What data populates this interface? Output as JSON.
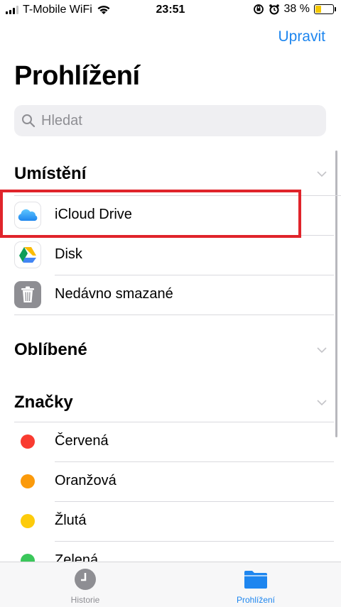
{
  "status": {
    "carrier": "T-Mobile WiFi",
    "time": "23:51",
    "battery": "38 %",
    "battery_level": 0.38
  },
  "header": {
    "edit_label": "Upravit",
    "title": "Prohlížení"
  },
  "search": {
    "placeholder": "Hledat"
  },
  "sections": {
    "locations": {
      "title": "Umístění",
      "items": [
        {
          "label": "iCloud Drive",
          "icon": "icloud-icon"
        },
        {
          "label": "Disk",
          "icon": "google-drive-icon"
        },
        {
          "label": "Nedávno smazané",
          "icon": "trash-icon"
        }
      ]
    },
    "favorites": {
      "title": "Oblíbené"
    },
    "tags": {
      "title": "Značky",
      "items": [
        {
          "label": "Červená",
          "color": "#f93b30"
        },
        {
          "label": "Oranžová",
          "color": "#fb9a0b"
        },
        {
          "label": "Žlutá",
          "color": "#fdcb0b"
        },
        {
          "label": "Zelená",
          "color": "#3ac75a"
        }
      ]
    }
  },
  "tabbar": {
    "tabs": [
      {
        "label": "Historie",
        "icon": "clock-icon",
        "active": false
      },
      {
        "label": "Prohlížení",
        "icon": "folder-icon",
        "active": true
      }
    ],
    "active_color": "#1e86ef",
    "inactive_color": "#8e8e93"
  },
  "highlight_color": "#e0242b"
}
